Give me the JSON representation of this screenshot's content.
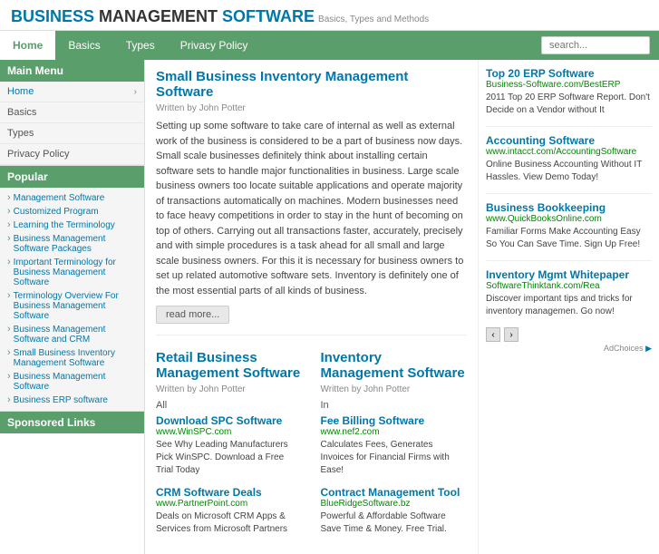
{
  "header": {
    "word_business": "BUSINESS",
    "word_management": " MANAGEMENT",
    "word_software": " SOFTWARE",
    "subtitle": "Basics, Types and Methods"
  },
  "nav": {
    "items": [
      {
        "label": "Home",
        "active": true
      },
      {
        "label": "Basics",
        "active": false
      },
      {
        "label": "Types",
        "active": false
      },
      {
        "label": "Privacy Policy",
        "active": false
      }
    ],
    "search_placeholder": "search..."
  },
  "sidebar": {
    "main_menu_label": "Main Menu",
    "menu_items": [
      {
        "label": "Home"
      },
      {
        "label": "Basics"
      },
      {
        "label": "Types"
      },
      {
        "label": "Privacy Policy"
      }
    ],
    "popular_label": "Popular",
    "popular_items": [
      "Management Software",
      "Customized Program",
      "Learning the Terminology",
      "Business Management Software Packages",
      "Important Terminology for Business Management Software",
      "Terminology Overview For Business Management Software",
      "Business Management Software and CRM",
      "Small Business Inventory Management Software",
      "Business Management Software",
      "Business ERP software"
    ],
    "sponsored_label": "Sponsored Links"
  },
  "main_article": {
    "title": "Small Business Inventory Management Software",
    "meta": "Written by John Potter",
    "body": "Setting up some software to take care of internal as well as external work of the business is considered to be a part of business now days. Small scale businesses definitely think about installing certain software sets to handle major functionalities in business. Large scale business owners too locate suitable applications and operate majority of transactions automatically on machines. Modern businesses need to face heavy competitions in order to stay in the hunt of becoming on top of others. Carrying out all transactions faster, accurately, precisely and with simple procedures is a task ahead for all small and large scale business owners. For this it is necessary for business owners to set up related automotive software sets. Inventory is definitely one of the most essential parts of all kinds of business.",
    "read_more": "read more..."
  },
  "bottom_articles": [
    {
      "title": "Retail Business Management Software",
      "meta": "Written by John Potter",
      "prefix": "All",
      "ads": [
        {
          "title": "Download SPC Software",
          "url": "www.WinSPC.com",
          "desc": "See Why Leading Manufacturers Pick WinSPC. Download a Free Trial Today"
        },
        {
          "title": "CRM Software Deals",
          "url": "www.PartnerPoint.com",
          "desc": "Deals on Microsoft CRM Apps & Services from Microsoft Partners"
        }
      ]
    },
    {
      "title": "Inventory Management Software",
      "meta": "Written by John Potter",
      "prefix": "In",
      "ads": [
        {
          "title": "Fee Billing Software",
          "url": "www.nef2.com",
          "desc": "Calculates Fees, Generates Invoices for Financial Firms with Ease!"
        },
        {
          "title": "Contract Management Tool",
          "url": "BlueRidgeSoftware.bz",
          "desc": "Powerful & Affordable Software Save Time & Money. Free Trial."
        }
      ]
    }
  ],
  "ads": [
    {
      "title": "Top 20 ERP Software",
      "url": "Business-Software.com/BestERP",
      "desc": "2011 Top 20 ERP Software Report. Don't Decide on a Vendor without It"
    },
    {
      "title": "Accounting Software",
      "url": "www.intacct.com/AccountingSoftware",
      "desc": "Online Business Accounting Without IT Hassles. View Demo Today!"
    },
    {
      "title": "Business Bookkeeping",
      "url": "www.QuickBooksOnline.com",
      "desc": "Familiar Forms Make Accounting Easy So You Can Save Time. Sign Up Free!"
    },
    {
      "title": "Inventory Mgmt Whitepaper",
      "url": "SoftwareThinktank.com/Rea",
      "desc": "Discover important tips and tricks for inventory managemen. Go now!"
    }
  ],
  "adchoices_label": "AdChoices"
}
